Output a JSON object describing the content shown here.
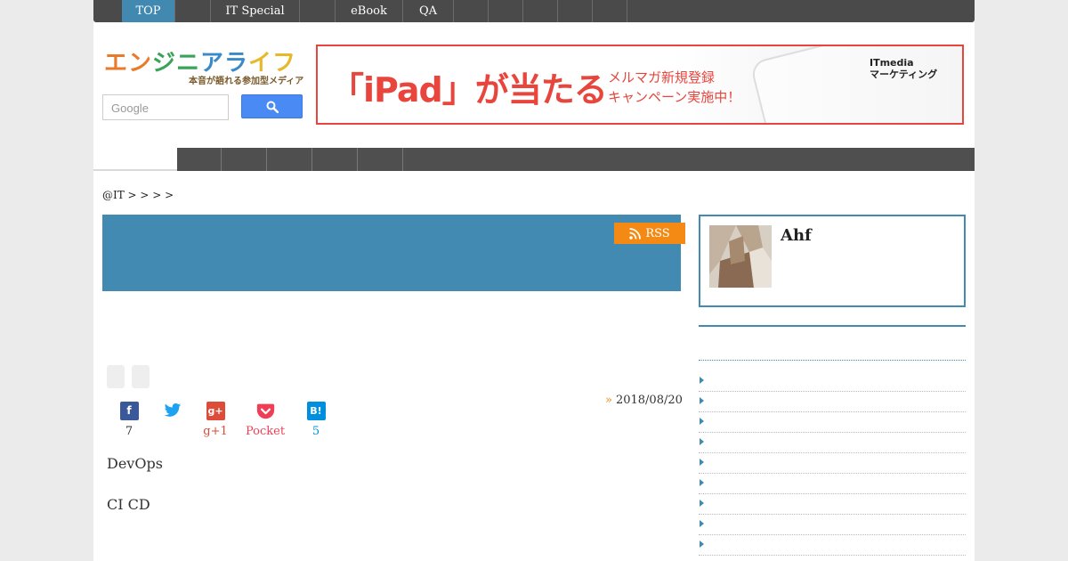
{
  "topnav": {
    "items": [
      {
        "label": "TOP",
        "active": true
      },
      {
        "label": ""
      },
      {
        "label": "IT Special"
      },
      {
        "label": ""
      },
      {
        "label": "eBook"
      },
      {
        "label": "QA"
      },
      {
        "label": ""
      },
      {
        "label": ""
      },
      {
        "label": ""
      },
      {
        "label": ""
      },
      {
        "label": ""
      }
    ]
  },
  "header": {
    "logo_text": "エンジニアライフ",
    "logo_tagline": "本音が語れる参加型メディア",
    "search_placeholder": "Google",
    "search_icon": "search-icon"
  },
  "banner": {
    "headline": "「iPad」が当たる",
    "line1": "メルマガ新規登録",
    "line2": "キャンペーン実施中！",
    "brand_top": "ITmedia",
    "brand_bottom": "マーケティング"
  },
  "breadcrumb": "@IT >   >  >  >",
  "article": {
    "rss_label": "RSS",
    "date": "2018/08/20",
    "paragraph1": "DevOps",
    "paragraph2": "CI  CD"
  },
  "share": [
    {
      "name": "facebook",
      "icon": "facebook-icon",
      "glyph": "f",
      "count": "7",
      "color": "#3b5998"
    },
    {
      "name": "twitter",
      "icon": "twitter-icon",
      "glyph": "",
      "count": "",
      "color": "#1da1f2"
    },
    {
      "name": "googleplus",
      "icon": "google-plus-icon",
      "glyph": "g+",
      "count": "g+1",
      "color": "#dd4b39"
    },
    {
      "name": "pocket",
      "icon": "pocket-icon",
      "glyph": "",
      "count": "Pocket",
      "color": "#ef3f56"
    },
    {
      "name": "hatena",
      "icon": "hatena-bookmark-icon",
      "glyph": "B!",
      "count": "5",
      "color": "#008fde"
    }
  ],
  "profile": {
    "name": "Ahf"
  },
  "colors": {
    "accent": "#428ab2",
    "orange": "#f48a14",
    "nav": "#4a4a4a",
    "banner_red": "#e8453c"
  }
}
